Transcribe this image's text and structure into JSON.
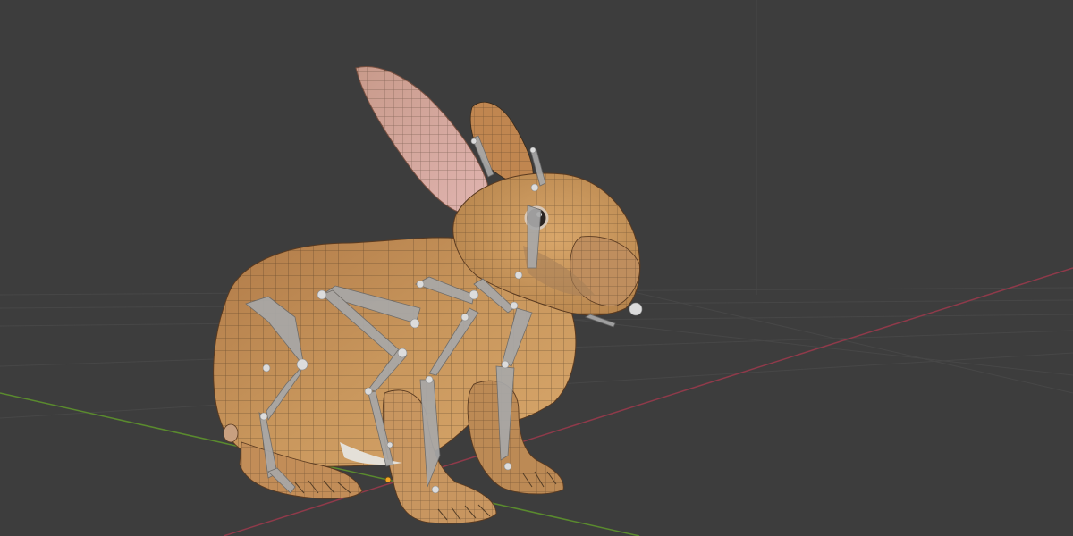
{
  "viewport": {
    "mode": "3d-viewport",
    "shading": "textured-wireframe-overlay",
    "background_color": "#3d3d3d",
    "grid_color": "#4a4a4a",
    "x_axis_color": "#8f3a4a",
    "y_axis_color": "#5a8a2e",
    "mesh_color": "#c8965c",
    "mesh_shadow_color": "#8a5a30",
    "ear_inner_color": "#d8a8a8",
    "wire_color": "#3a2a1a",
    "bone_color": "#a8a8a8",
    "bone_head_color": "#d8d8d8",
    "origin_color": "#f5a623",
    "object": "rabbit-mesh",
    "armature": "rabbit-armature"
  }
}
